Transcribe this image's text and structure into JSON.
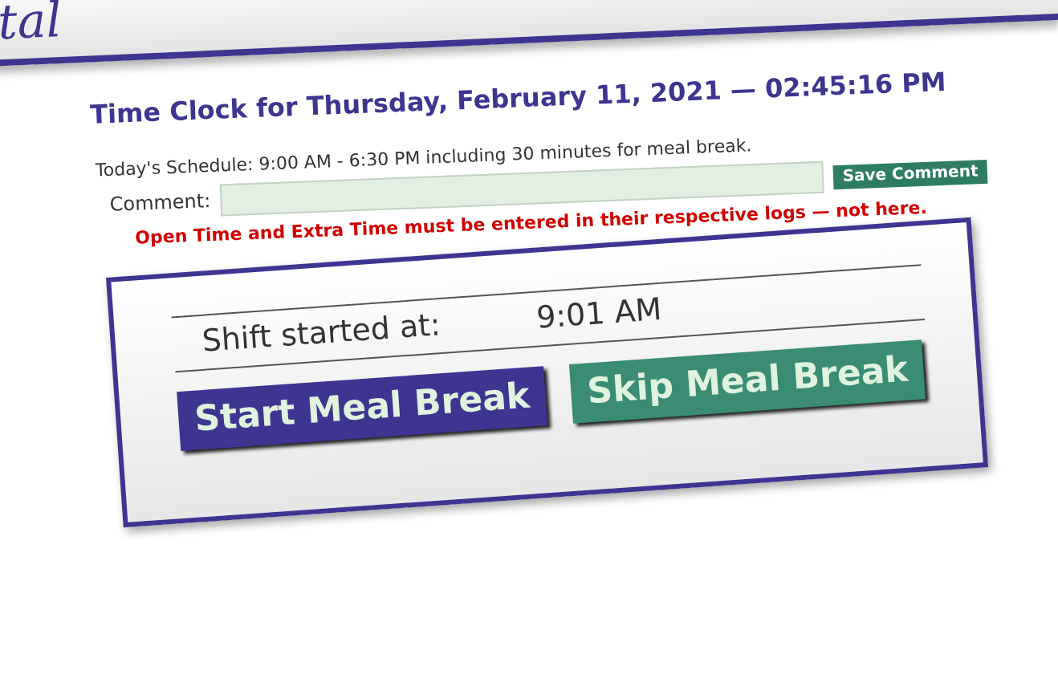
{
  "header": {
    "logo_text": "tal"
  },
  "time_clock": {
    "title": "Time Clock for Thursday, February 11, 2021 — 02:45:16 PM",
    "schedule": "Today's Schedule: 9:00 AM - 6:30 PM including 30 minutes for meal break.",
    "comment_label": "Comment:",
    "save_button": "Save Comment",
    "warning": "Open Time and Extra Time must be entered in their respective logs — not here."
  },
  "shift": {
    "label": "Shift started at:",
    "time": "9:01 AM",
    "buttons": [
      {
        "label": "Start Meal Break",
        "kind": "primary"
      },
      {
        "label": "Skip Meal Break",
        "kind": "secondary"
      }
    ]
  }
}
